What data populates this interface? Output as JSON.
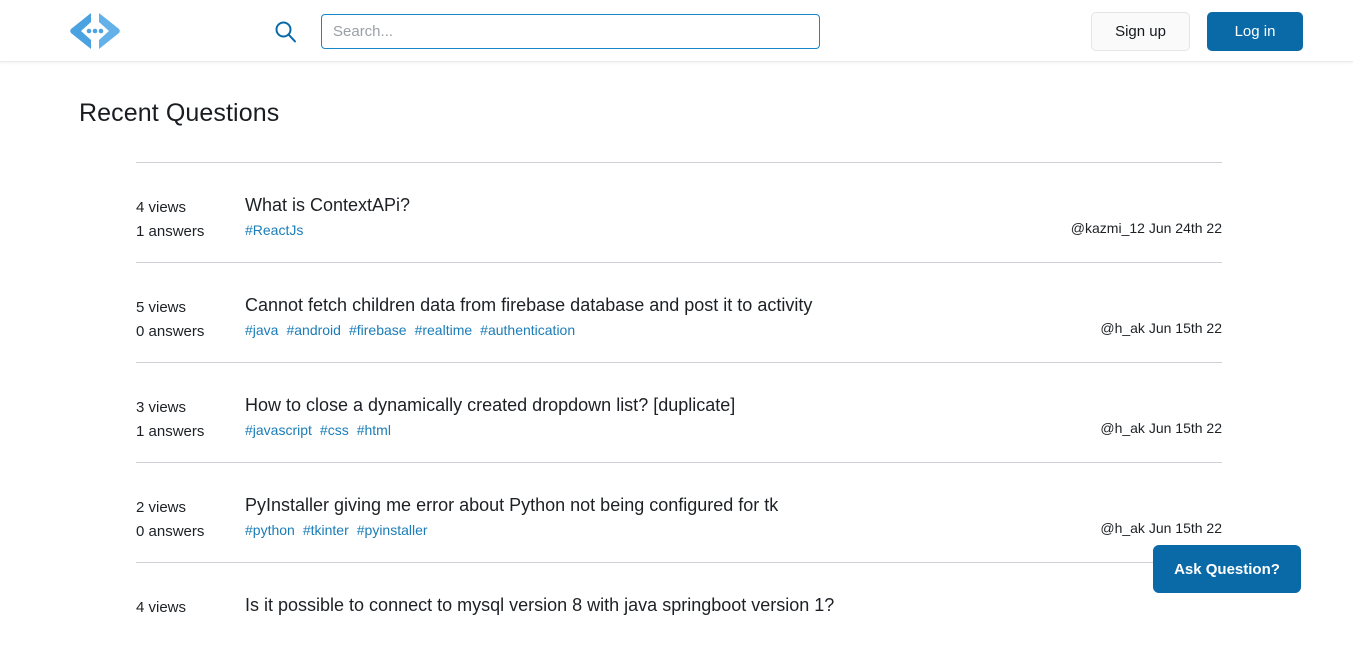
{
  "header": {
    "logo_icon": "code-brackets-logo",
    "logo_color": "#4aa3e0",
    "search_icon": "search-icon",
    "search": {
      "value": "",
      "placeholder": "Search..."
    },
    "sign_up_label": "Sign up",
    "log_in_label": "Log in",
    "accent_color": "#0a6aa8"
  },
  "main": {
    "page_title": "Recent Questions",
    "questions": [
      {
        "views": "4 views",
        "answers": "1 answers",
        "title": "What is ContextAPi?",
        "tags": [
          "#ReactJs"
        ],
        "meta": "@kazmi_12 Jun 24th 22"
      },
      {
        "views": "5 views",
        "answers": "0 answers",
        "title": "Cannot fetch children data from firebase database and post it to activity",
        "tags": [
          "#java",
          "#android",
          "#firebase",
          "#realtime",
          "#authentication"
        ],
        "meta": "@h_ak Jun 15th 22"
      },
      {
        "views": "3 views",
        "answers": "1 answers",
        "title": "How to close a dynamically created dropdown list? [duplicate]",
        "tags": [
          "#javascript",
          "#css",
          "#html"
        ],
        "meta": "@h_ak Jun 15th 22"
      },
      {
        "views": "2 views",
        "answers": "0 answers",
        "title": "PyInstaller giving me error about Python not being configured for tk",
        "tags": [
          "#python",
          "#tkinter",
          "#pyinstaller"
        ],
        "meta": "@h_ak Jun 15th 22"
      },
      {
        "views": "4 views",
        "answers": "",
        "title": "Is it possible to connect to mysql version 8 with java springboot version 1?",
        "tags": [],
        "meta": ""
      }
    ]
  },
  "floating": {
    "ask_question_label": "Ask Question?"
  }
}
